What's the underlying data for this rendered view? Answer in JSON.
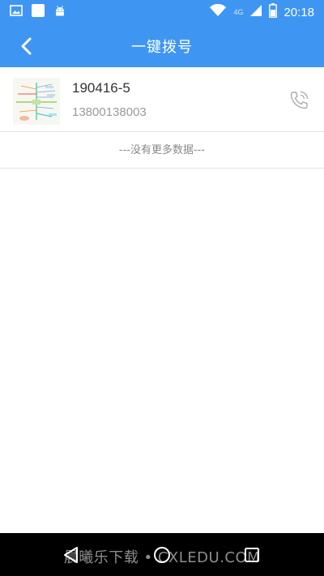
{
  "status_bar": {
    "time": "20:18",
    "network": "4G",
    "icons": [
      "image-icon",
      "notification-square-icon",
      "android-icon",
      "wifi-icon",
      "signal-icon",
      "battery-icon"
    ]
  },
  "header": {
    "title": "一键拨号",
    "back_icon": "chevron-left-icon",
    "background": "#3f96f2"
  },
  "contacts": [
    {
      "name": "190416-5",
      "phone": "13800138003",
      "call_icon": "phone-call-icon"
    }
  ],
  "list_footer": "---没有更多数据---",
  "nav_bar": {
    "buttons": [
      "back-triangle-icon",
      "home-circle-icon",
      "recents-square-icon"
    ],
    "watermark": "晨曦乐下载 • CXLEDU.COM"
  },
  "colors": {
    "accent": "#3f96f2",
    "text_primary": "#333333",
    "text_secondary": "#9a9a9a",
    "divider": "#e2e2e2"
  }
}
